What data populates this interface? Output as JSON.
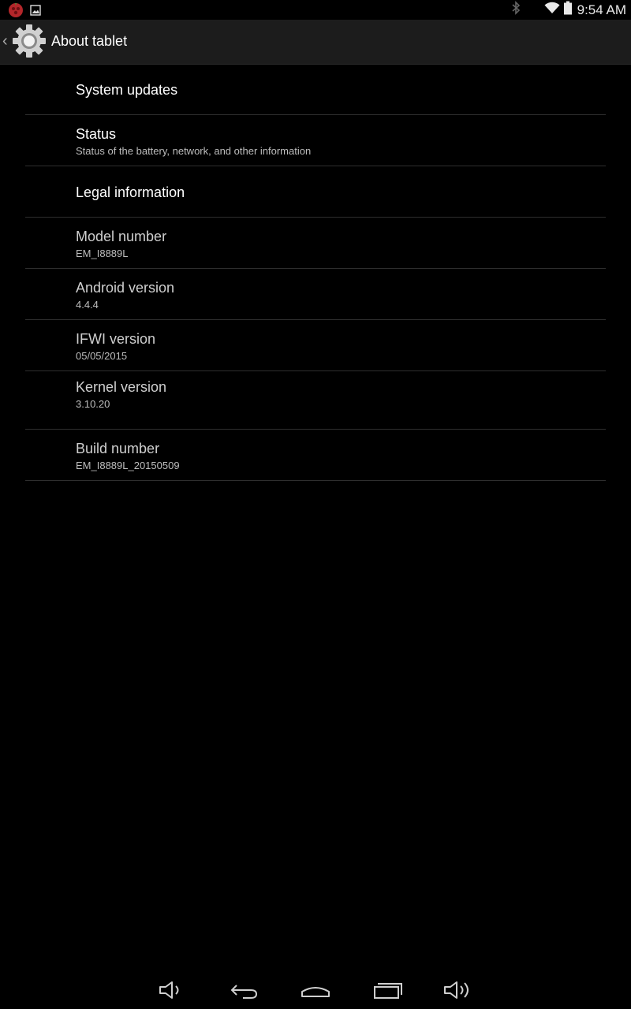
{
  "status_bar": {
    "time": "9:54 AM",
    "icons_left": [
      "app-notification-icon",
      "image-notification-icon"
    ],
    "icons_right": [
      "bluetooth-icon",
      "wifi-icon",
      "battery-icon"
    ]
  },
  "action_bar": {
    "title": "About tablet",
    "icon": "settings-gear-icon"
  },
  "items": [
    {
      "label": "System updates",
      "summary": ""
    },
    {
      "label": "Status",
      "summary": "Status of the battery, network, and other information"
    },
    {
      "label": "Legal information",
      "summary": ""
    },
    {
      "label": "Model number",
      "summary": "EM_I8889L"
    },
    {
      "label": "Android version",
      "summary": "4.4.4"
    },
    {
      "label": "IFWI version",
      "summary": "05/05/2015"
    },
    {
      "label": "Kernel version",
      "summary": "3.10.20"
    },
    {
      "label": "Build number",
      "summary": "EM_I8889L_20150509"
    }
  ],
  "nav_bar": {
    "buttons": [
      "volume-down-icon",
      "back-icon",
      "home-icon",
      "recents-icon",
      "volume-up-icon"
    ]
  }
}
